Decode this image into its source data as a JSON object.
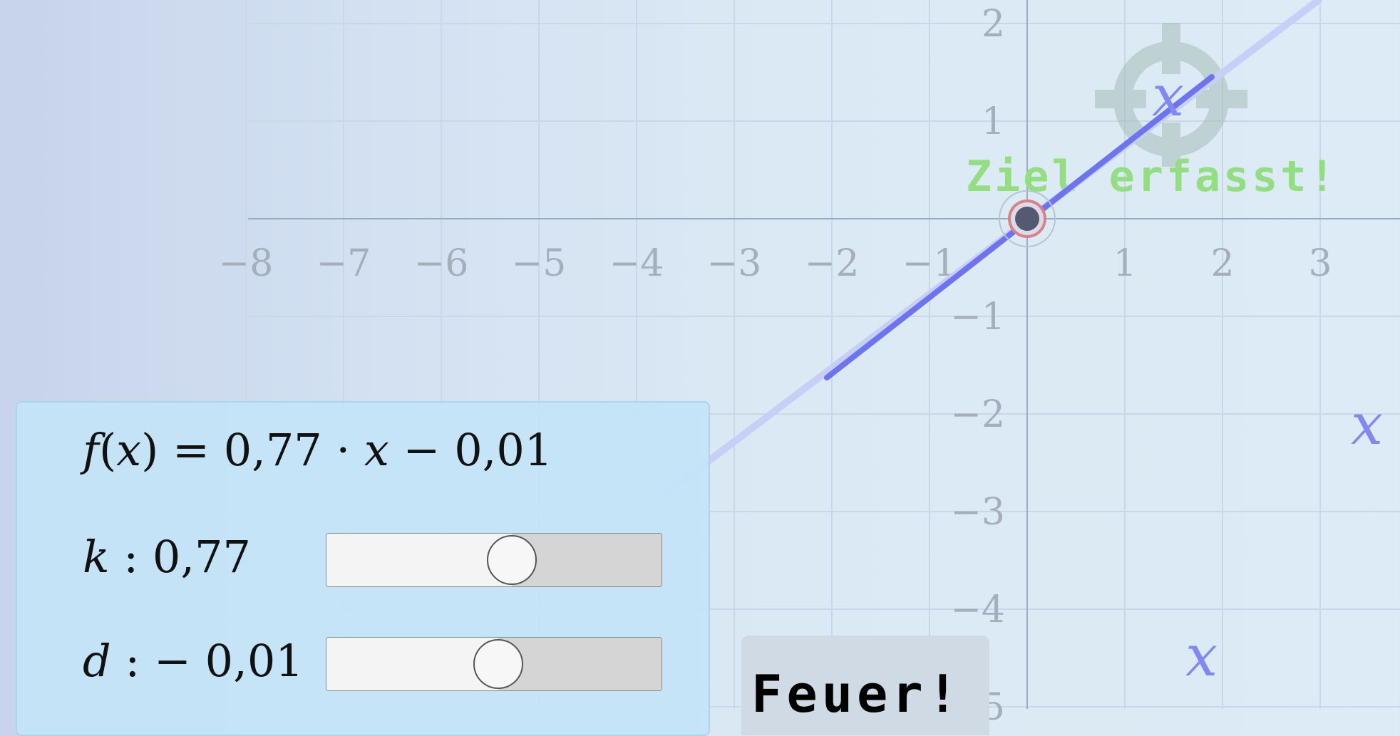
{
  "graph": {
    "x_ticks": [
      "−8",
      "−7",
      "−6",
      "−5",
      "−4",
      "−3",
      "−2",
      "−1",
      "1",
      "2",
      "3"
    ],
    "y_ticks": [
      "2",
      "1",
      "−1",
      "−2",
      "−3",
      "−4",
      "−5"
    ],
    "var_labels": [
      "x",
      "x",
      "x"
    ],
    "status_text": "Ziel erfasst!",
    "line_color": "#6e73ee",
    "status_color": "#93dd83"
  },
  "controls": {
    "function_text": {
      "prefix": "f",
      "arg": "x",
      "middle": " = 0,77 · ",
      "var": "x",
      "suffix": " − 0,01"
    },
    "k": {
      "name": "k",
      "value_text": " : 0,77",
      "value": 0.77,
      "slider_fraction": 0.55
    },
    "d": {
      "name": "d",
      "value_text": " : − 0,01",
      "value": -0.01,
      "slider_fraction": 0.51
    }
  },
  "fire_button": {
    "label": "Feuer!"
  }
}
